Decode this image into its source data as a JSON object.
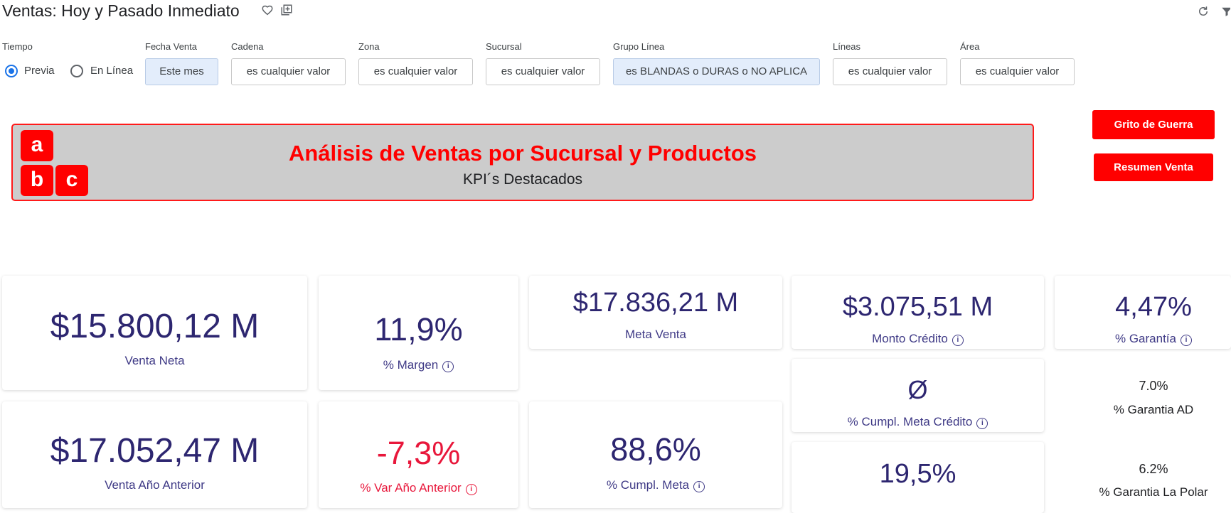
{
  "header": {
    "title": "Ventas: Hoy y Pasado Inmediato",
    "icons": [
      "heart-icon",
      "copy-icon",
      "refresh-icon",
      "filter-icon"
    ]
  },
  "filters": {
    "tiempo": {
      "label": "Tiempo",
      "options": [
        "Previa",
        "En Línea"
      ],
      "selected": "Previa"
    },
    "fecha_venta": {
      "label": "Fecha Venta",
      "value": "Este mes"
    },
    "cadena": {
      "label": "Cadena",
      "value": "es cualquier valor"
    },
    "zona": {
      "label": "Zona",
      "value": "es cualquier valor"
    },
    "sucursal": {
      "label": "Sucursal",
      "value": "es cualquier valor"
    },
    "grupo_linea": {
      "label": "Grupo Línea",
      "value": "es BLANDAS o DURAS o NO APLICA"
    },
    "lineas": {
      "label": "Líneas",
      "value": "es cualquier valor"
    },
    "area": {
      "label": "Área",
      "value": "es cualquier valor"
    }
  },
  "banner": {
    "logo_letters": [
      "a",
      "b",
      "c"
    ],
    "title": "Análisis de Ventas por Sucursal y Productos",
    "subtitle": "KPI´s Destacados"
  },
  "buttons": {
    "grito": "Grito de Guerra",
    "resumen": "Resumen Venta"
  },
  "kpis": {
    "venta_neta": {
      "value": "$15.800,12 M",
      "label": "Venta Neta"
    },
    "margen": {
      "value": "11,9%",
      "label": "% Margen"
    },
    "meta_venta": {
      "value": "$17.836,21 M",
      "label": "Meta Venta"
    },
    "monto_credito": {
      "value": "$3.075,51 M",
      "label": "Monto Crédito"
    },
    "garantia": {
      "value": "4,47%",
      "label": "% Garantía"
    },
    "cumpl_meta_credito": {
      "value": "Ø",
      "label": "% Cumpl. Meta Crédito"
    },
    "garantia_ad": {
      "value": "7.0%",
      "label": "% Garantia AD"
    },
    "venta_anio_anterior": {
      "value": "$17.052,47 M",
      "label": "Venta Año Anterior"
    },
    "var_anio_anterior": {
      "value": "-7,3%",
      "label": "% Var Año Anterior"
    },
    "cumpl_meta": {
      "value": "88,6%",
      "label": "% Cumpl. Meta"
    },
    "bottom_value": {
      "value": "19,5%"
    },
    "garantia_la_polar": {
      "value": "6.2%",
      "label": "% Garantia La Polar"
    }
  },
  "info_glyph": "i",
  "colors": {
    "accent_red": "#ff0000",
    "kpi_text": "#2d2670",
    "negative": "#e8173b",
    "selected_filter": "#e3edfb",
    "radio_blue": "#1a73e8"
  }
}
